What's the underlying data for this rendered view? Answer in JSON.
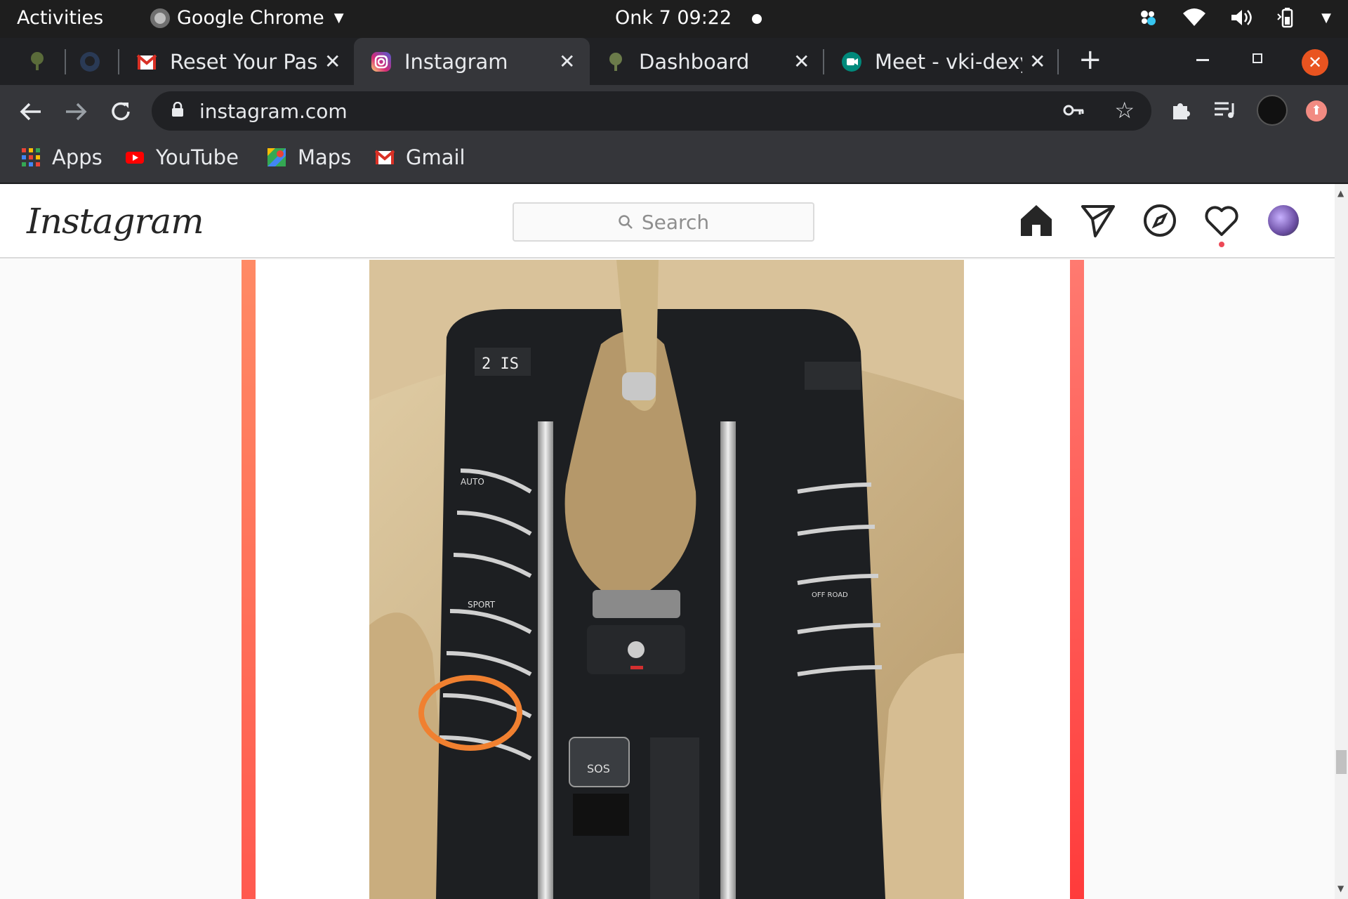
{
  "system_bar": {
    "activities": "Activities",
    "app_name": "Google Chrome",
    "clock": "Onk 7  09:22"
  },
  "tabs": [
    {
      "title": "Reset Your Pas",
      "favicon": "gmail-icon"
    },
    {
      "title": "Instagram",
      "favicon": "instagram-icon",
      "active": true
    },
    {
      "title": "Dashboard",
      "favicon": "tree-icon"
    },
    {
      "title": "Meet - vki-dexy",
      "favicon": "meet-icon"
    }
  ],
  "address_bar": {
    "url": "instagram.com"
  },
  "bookmarks": [
    {
      "label": "Apps",
      "icon": "apps-grid-icon"
    },
    {
      "label": "YouTube",
      "icon": "youtube-icon"
    },
    {
      "label": "Maps",
      "icon": "maps-icon"
    },
    {
      "label": "Gmail",
      "icon": "gmail-icon"
    }
  ],
  "instagram": {
    "logo": "Instagram",
    "search_placeholder": "Search",
    "nav": [
      "home-icon",
      "direct-icon",
      "explore-icon",
      "activity-heart-icon",
      "profile-avatar"
    ],
    "accent": "#ed4956"
  },
  "post_image": {
    "description_icon": "car-center-console-photo",
    "photo_labels": [
      "2 IS",
      "SPORT",
      "AUTO",
      "OFF ROAD",
      "SOS"
    ]
  }
}
